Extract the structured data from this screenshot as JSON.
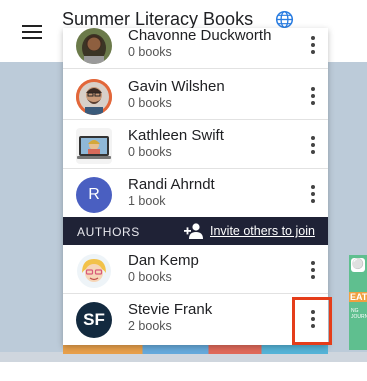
{
  "header": {
    "title": "Summer Literacy Books",
    "menu_icon": "hamburger-menu-icon",
    "globe_icon": "globe-icon"
  },
  "readers": [
    {
      "name": "Chavonne Duckworth",
      "count": "0 books",
      "avatar": "photo"
    },
    {
      "name": "Gavin Wilshen",
      "count": "0 books",
      "avatar": "photo"
    },
    {
      "name": "Kathleen Swift",
      "count": "0 books",
      "avatar": "photo"
    },
    {
      "name": "Randi Ahrndt",
      "count": "1 book",
      "avatar": "R"
    }
  ],
  "authors_section": {
    "label": "AUTHORS",
    "invite_label": "Invite others to join",
    "invite_icon": "add-person-icon"
  },
  "authors": [
    {
      "name": "Dan Kemp",
      "count": "0 books",
      "avatar": "photo"
    },
    {
      "name": "Stevie Frank",
      "count": "2 books",
      "avatar": "SF"
    }
  ],
  "background": {
    "book_label": "EATO",
    "book_sublabel": "NG JOURN"
  },
  "colors": {
    "authors_bar": "#1f2236",
    "highlight": "#e53d1a",
    "avatar_r": "#4a5fc1",
    "avatar_sf": "#132a3f"
  }
}
